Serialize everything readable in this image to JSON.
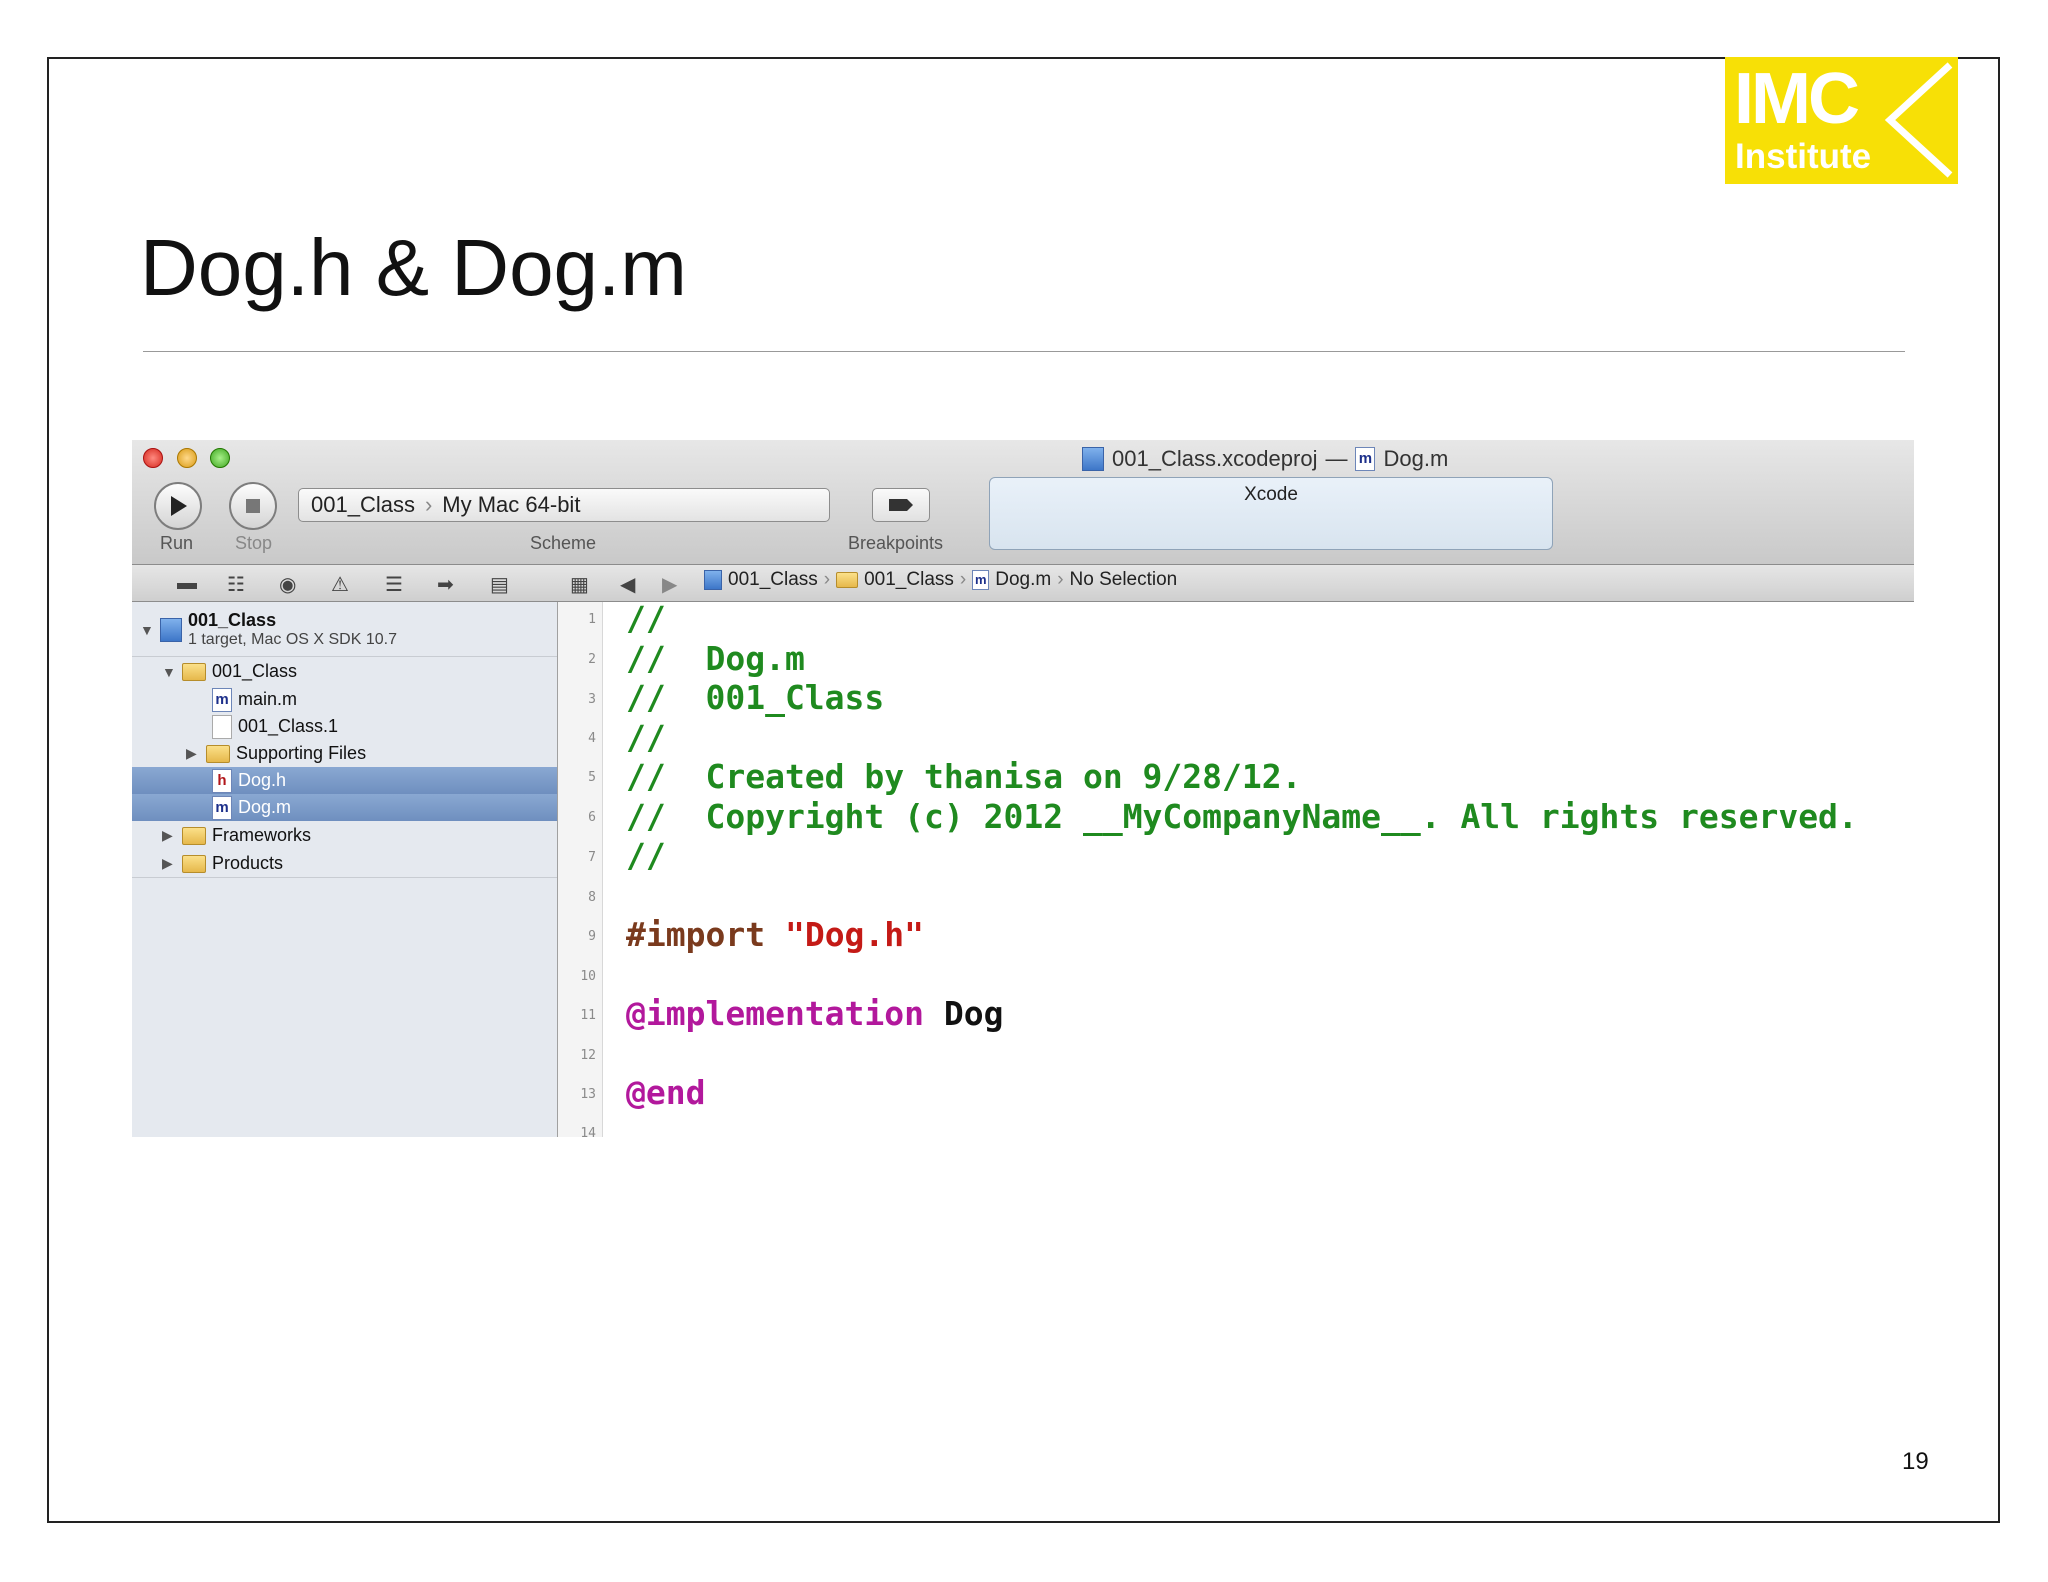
{
  "slide": {
    "title": "Dog.h & Dog.m",
    "page_number": "19",
    "logo": {
      "line1": "IMC",
      "line2": "Institute",
      "bg_color": "#f7e006"
    }
  },
  "window": {
    "title_project": "001_Class.xcodeproj",
    "title_separator": "—",
    "title_file": "Dog.m",
    "toolbar": {
      "run_label": "Run",
      "stop_label": "Stop",
      "scheme_target": "001_Class",
      "scheme_destination": "My Mac 64-bit",
      "scheme_label": "Scheme",
      "breakpoints_label": "Breakpoints",
      "activity_text": "Xcode"
    },
    "jump_bar": {
      "crumbs": [
        "001_Class",
        "001_Class",
        "Dog.m",
        "No Selection"
      ]
    },
    "navigator": {
      "project_name": "001_Class",
      "project_subtitle": "1 target, Mac OS X SDK 10.7",
      "items": [
        {
          "label": "001_Class",
          "icon": "folder-icon"
        },
        {
          "label": "main.m",
          "icon": "m-file-icon"
        },
        {
          "label": "001_Class.1",
          "icon": "document-icon"
        },
        {
          "label": "Supporting Files",
          "icon": "folder-icon"
        },
        {
          "label": "Dog.h",
          "icon": "h-file-icon"
        },
        {
          "label": "Dog.m",
          "icon": "m-file-icon"
        },
        {
          "label": "Frameworks",
          "icon": "folder-icon"
        },
        {
          "label": "Products",
          "icon": "folder-icon"
        }
      ]
    },
    "editor": {
      "line_numbers": [
        "1",
        "2",
        "3",
        "4",
        "5",
        "6",
        "7",
        "8",
        "9",
        "10",
        "11",
        "12",
        "13",
        "14"
      ],
      "lines": {
        "l1": "//",
        "l2": "//  Dog.m",
        "l3": "//  001_Class",
        "l4": "//",
        "l5": "//  Created by thanisa on 9/28/12.",
        "l6": "//  Copyright (c) 2012 __MyCompanyName__. All rights reserved.",
        "l7": "//",
        "l9_directive": "#import",
        "l9_string": "\"Dog.h\"",
        "l11_keyword": "@implementation",
        "l11_name": "Dog",
        "l13": "@end"
      },
      "colors": {
        "comment": "#1f8a1f",
        "preprocessor": "#7a3a1d",
        "string": "#c41a16",
        "keyword": "#b2189c"
      }
    }
  }
}
